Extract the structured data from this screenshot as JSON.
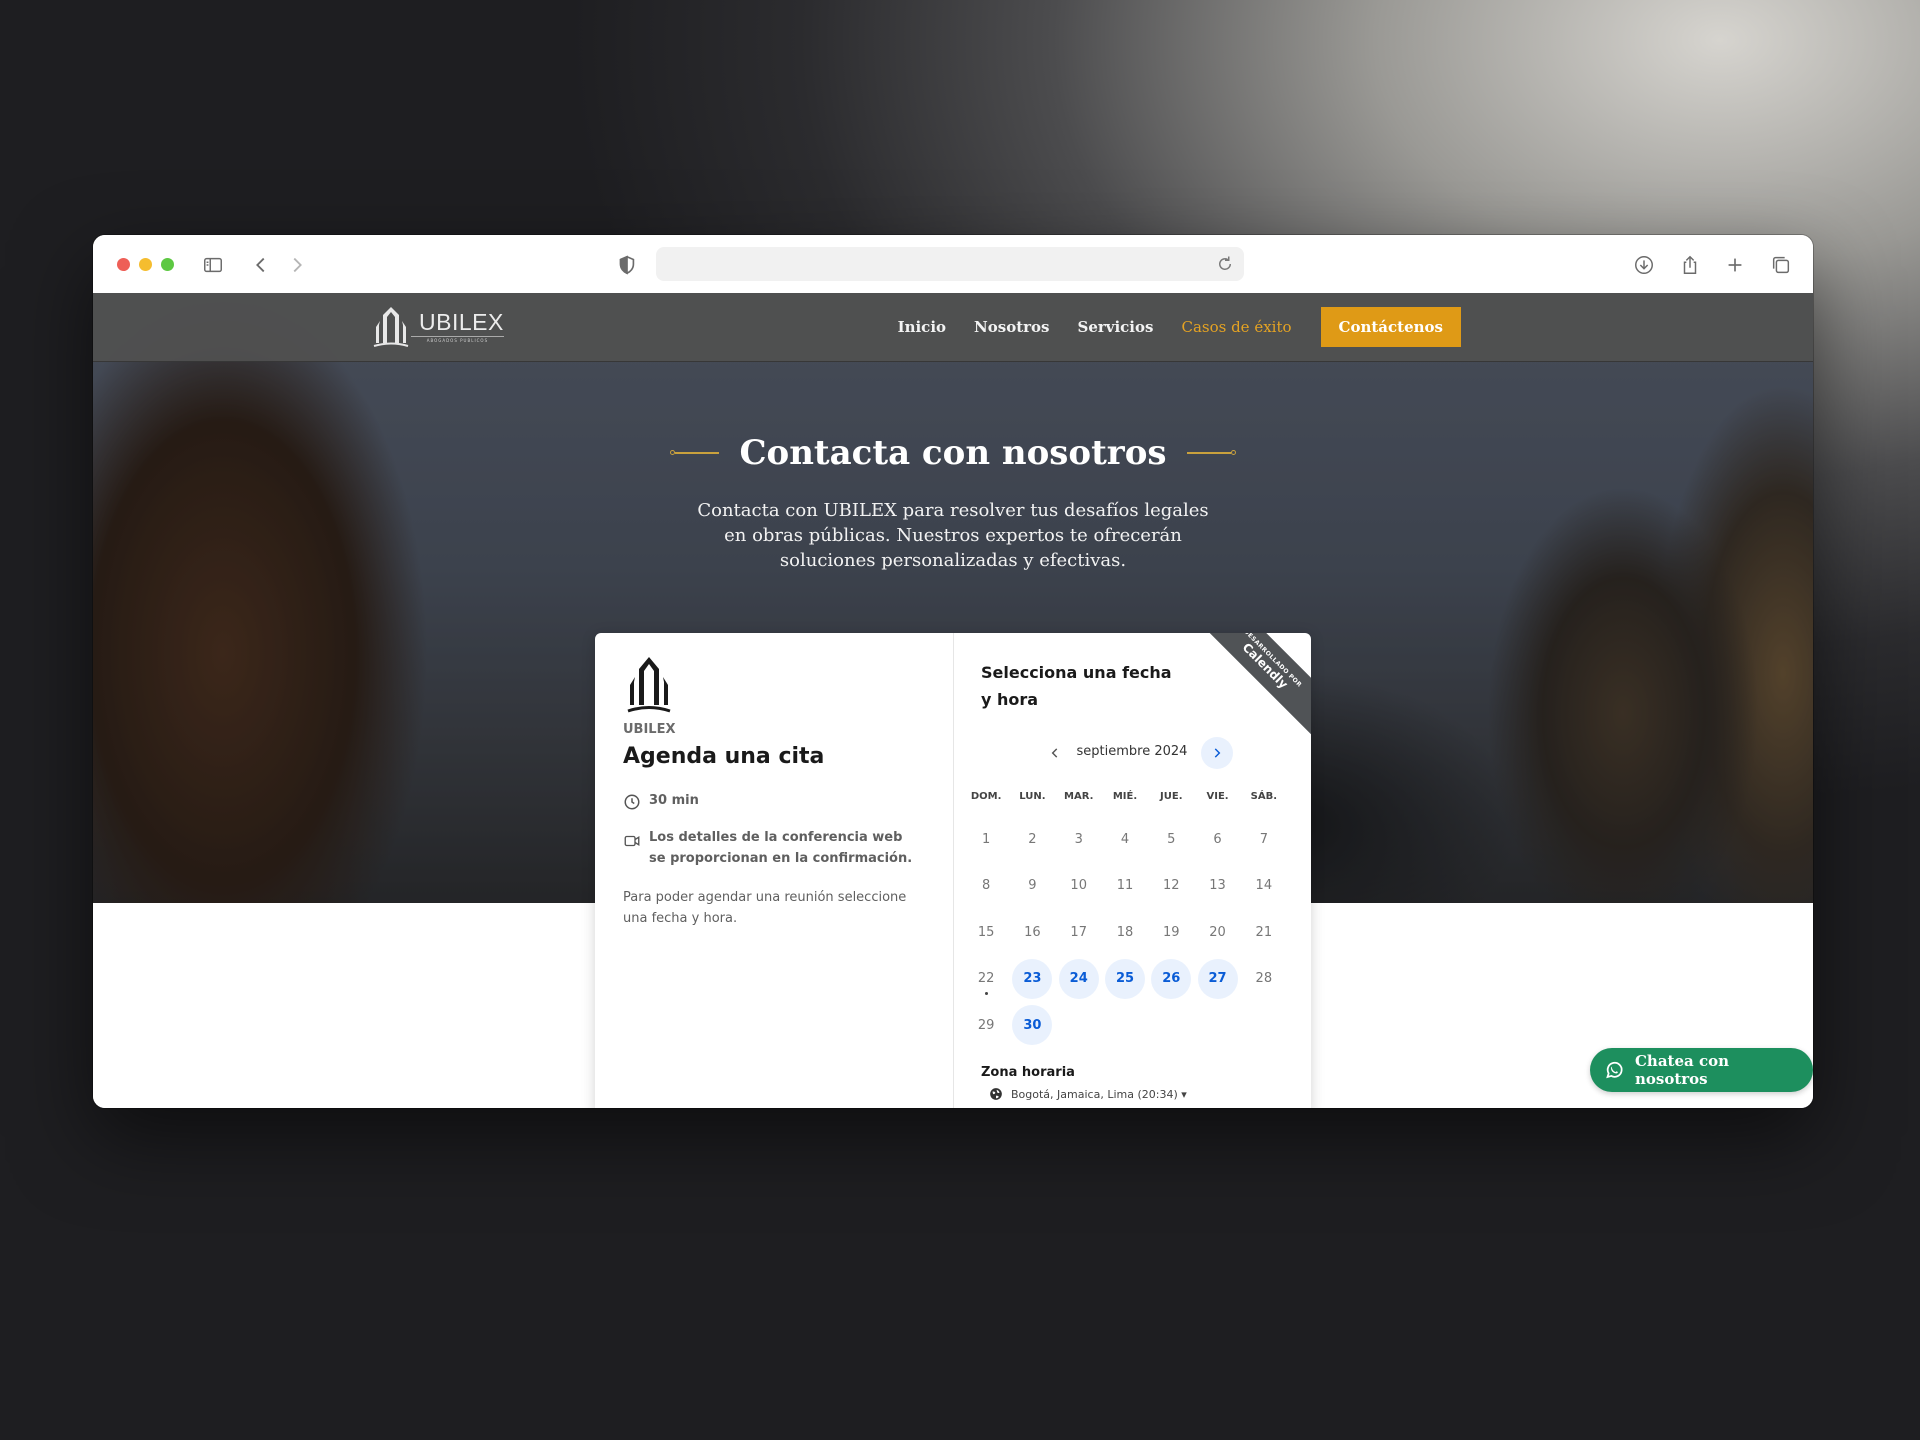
{
  "browser": {
    "url": ""
  },
  "nav": {
    "logo_text": "UBILEX",
    "logo_sub": "ABOGADOS PUBLICOS",
    "links": [
      {
        "label": "Inicio"
      },
      {
        "label": "Nosotros"
      },
      {
        "label": "Servicios"
      },
      {
        "label": "Casos de éxito"
      }
    ],
    "cta": "Contáctenos"
  },
  "hero": {
    "title": "Contacta con nosotros",
    "description": "Contacta con UBILEX para resolver tus desafíos legales en obras públicas. Nuestros expertos te ofrecerán soluciones personalizadas y efectivas."
  },
  "booking": {
    "org": "UBILEX",
    "event_title": "Agenda una cita",
    "duration": "30 min",
    "conference_note": "Los detalles de la conferencia web se proporcionan en la confirmación.",
    "instructions": "Para poder agendar una reunión seleccione una fecha y hora.",
    "select_title": "Selecciona una fecha y hora",
    "ribbon_small": "DESARROLLADO POR",
    "ribbon_brand": "Calendly",
    "month": "septiembre 2024",
    "weekdays": [
      "DOM.",
      "LUN.",
      "MAR.",
      "MIÉ.",
      "JUE.",
      "VIE.",
      "SÁB."
    ],
    "weeks": [
      [
        "1",
        "2",
        "3",
        "4",
        "5",
        "6",
        "7"
      ],
      [
        "8",
        "9",
        "10",
        "11",
        "12",
        "13",
        "14"
      ],
      [
        "15",
        "16",
        "17",
        "18",
        "19",
        "20",
        "21"
      ],
      [
        "22",
        "23",
        "24",
        "25",
        "26",
        "27",
        "28"
      ],
      [
        "29",
        "30",
        "",
        "",
        "",
        "",
        ""
      ]
    ],
    "available_days": [
      "23",
      "24",
      "25",
      "26",
      "27",
      "30"
    ],
    "today": "22",
    "timezone_label": "Zona horaria",
    "timezone_value": "Bogotá, Jamaica, Lima (20:34) ▾"
  },
  "chat_button": "Chatea con nosotros",
  "colors": {
    "accent": "#df9a16",
    "active_link": "#e5a323",
    "calendar_blue": "#0a5cd6",
    "whatsapp_green": "#1d8f5e"
  }
}
